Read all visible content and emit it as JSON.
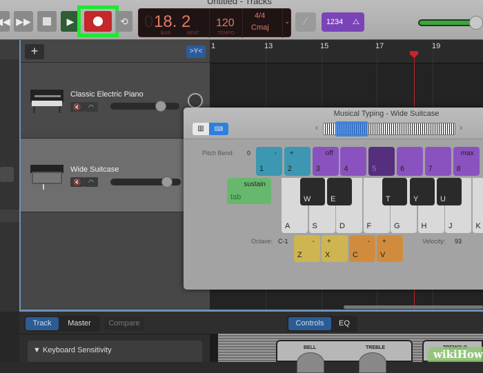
{
  "window": {
    "title": "Untitled - Tracks"
  },
  "toolbar": {
    "rewind_icon": "rewind-icon",
    "forward_icon": "fast-forward-icon",
    "stop_icon": "stop-icon",
    "play_icon": "play-icon",
    "record_icon": "record-icon",
    "cycle_icon": "cycle-icon",
    "lcd": {
      "bar_prefix": "0",
      "position": "18. 2",
      "bar_label": "BAR",
      "beat_label": "BEAT",
      "tempo": "120",
      "tempo_label": "TEMPO",
      "time_signature": "4/4",
      "key": "Cmaj"
    },
    "count_in": "1234",
    "tuner_icon": "tuner-icon",
    "metronome_icon": "metronome-icon",
    "master_volume": 0.9
  },
  "tracks_header": {
    "add_label": "+",
    "filter_label": ">Y<"
  },
  "tracks": [
    {
      "name": "Classic Electric Piano",
      "volume": 0.72,
      "selected": false
    },
    {
      "name": "Wide Suitcase",
      "volume": 0.78,
      "selected": true
    }
  ],
  "ruler": {
    "bars": [
      "1",
      "13",
      "15",
      "17",
      "19"
    ]
  },
  "musical_typing": {
    "title": "Musical Typing - Wide Suitcase",
    "pitch_bend_label": "Pitch Bend:",
    "pitch_bend_value": "0",
    "number_keys": [
      {
        "key": "1",
        "top": "-",
        "color": "blue"
      },
      {
        "key": "2",
        "top": "+",
        "color": "blue"
      },
      {
        "key": "3",
        "top": "off",
        "color": "purple"
      },
      {
        "key": "4",
        "top": "",
        "color": "purple"
      },
      {
        "key": "5",
        "top": "",
        "color": "dpurple"
      },
      {
        "key": "6",
        "top": "",
        "color": "purple"
      },
      {
        "key": "7",
        "top": "",
        "color": "purple"
      },
      {
        "key": "8",
        "top": "max",
        "color": "purple"
      }
    ],
    "sustain": {
      "label": "sustain",
      "key": "tab"
    },
    "white_keys": [
      "A",
      "S",
      "D",
      "F",
      "G",
      "H",
      "J",
      "K"
    ],
    "black_keys": [
      "W",
      "E",
      "T",
      "Y",
      "U"
    ],
    "octave_label": "Octave:",
    "octave_value": "C-1",
    "octave_keys": [
      {
        "key": "Z",
        "top": "-"
      },
      {
        "key": "X",
        "top": "+"
      }
    ],
    "velocity_keys": [
      {
        "key": "C",
        "top": "-"
      },
      {
        "key": "V",
        "top": "+"
      }
    ],
    "velocity_label": "Velocity:",
    "velocity_value": "93"
  },
  "bottom": {
    "tabs_left": [
      "Track",
      "Master",
      "Compare"
    ],
    "tabs_right": [
      "Controls",
      "EQ"
    ],
    "keyboard_sensitivity": "▼ Keyboard Sensitivity",
    "plugin_labels": [
      "BELL",
      "TREBLE",
      "TREMOLO"
    ]
  },
  "watermark": "wikiHow",
  "colors": {
    "record": "#c4282a",
    "highlight": "#22e634",
    "accent": "#2f7fde",
    "metronome": "#7a44b8"
  }
}
